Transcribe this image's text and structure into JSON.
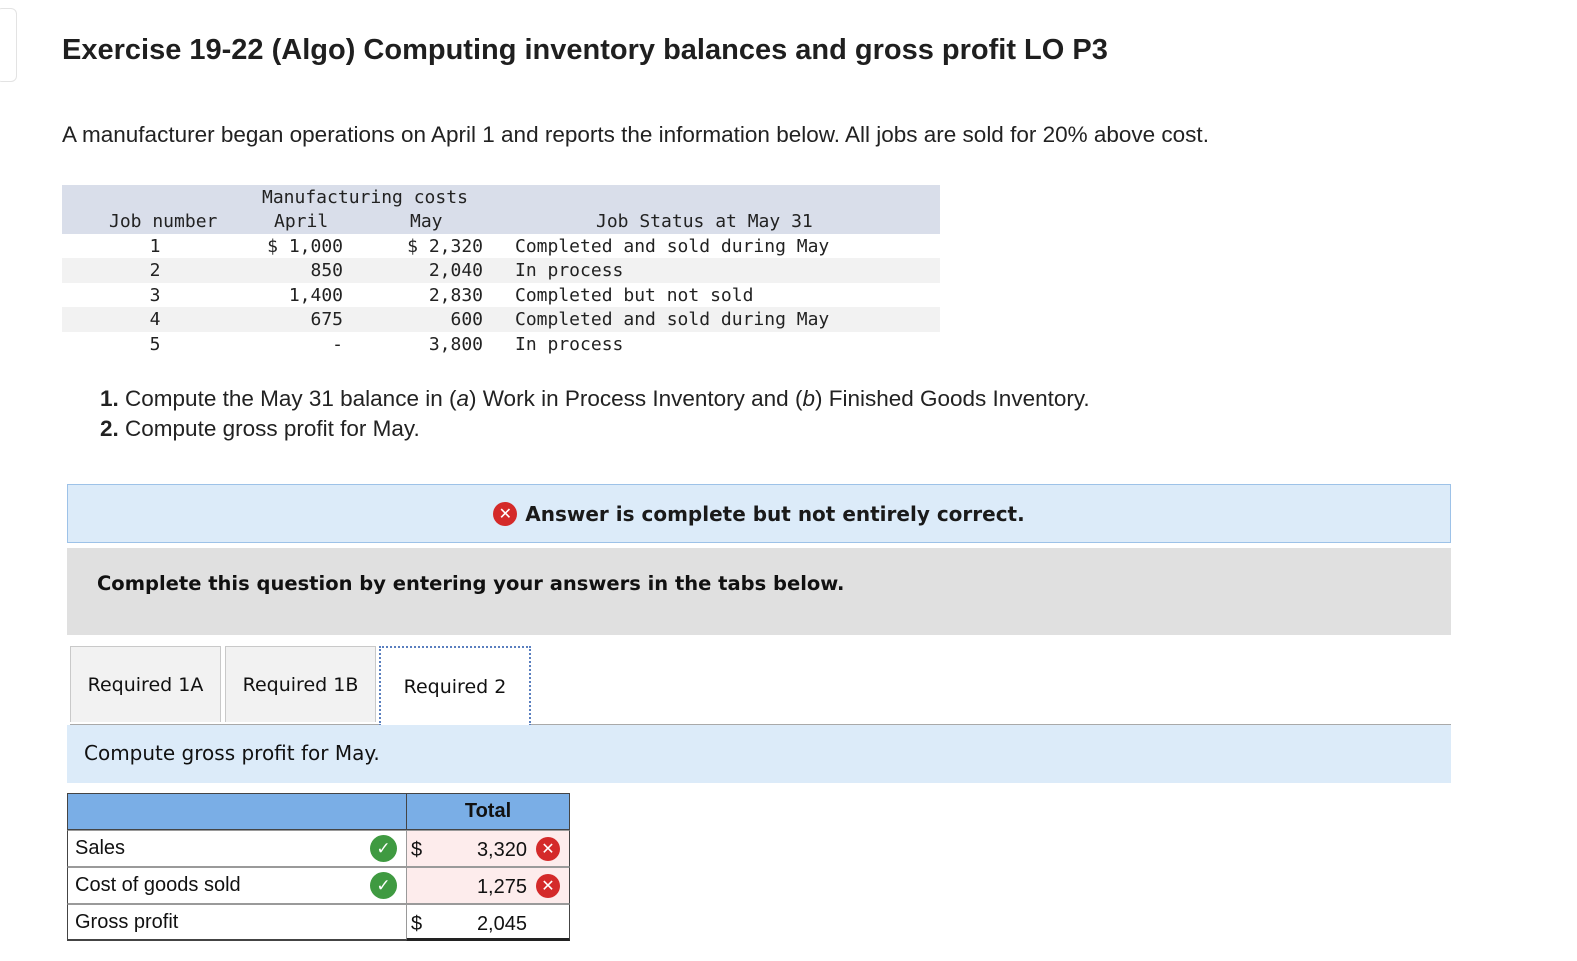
{
  "title": "Exercise 19-22 (Algo) Computing inventory balances and gross profit LO P3",
  "intro": "A manufacturer began operations on April 1 and reports the information below. All jobs are sold for 20% above cost.",
  "job_table": {
    "header_group": "Manufacturing costs",
    "headers": {
      "job": "Job number",
      "april": "April",
      "may": "May",
      "status": "Job Status at May 31"
    },
    "rows": [
      {
        "job": "1",
        "april": "$ 1,000",
        "may": "$ 2,320",
        "status": "Completed and sold during May"
      },
      {
        "job": "2",
        "april": "850",
        "may": "2,040",
        "status": "In process"
      },
      {
        "job": "3",
        "april": "1,400",
        "may": "2,830",
        "status": "Completed but not sold"
      },
      {
        "job": "4",
        "april": "675",
        "may": "600",
        "status": "Completed and sold during May"
      },
      {
        "job": "5",
        "april": "-",
        "may": "3,800",
        "status": "In process"
      }
    ]
  },
  "requirements": [
    {
      "num": "1.",
      "pre": "Compute the May 31 balance in (",
      "a": "a",
      "mid": ") Work in Process Inventory and (",
      "b": "b",
      "post": ") Finished Goods Inventory."
    },
    {
      "num": "2.",
      "text": "Compute gross profit for May."
    }
  ],
  "banner": {
    "icon": "x-icon",
    "text": "Answer is complete but not entirely correct."
  },
  "instruction": "Complete this question by entering your answers in the tabs below.",
  "tabs": [
    {
      "label": "Required 1A",
      "active": false
    },
    {
      "label": "Required 1B",
      "active": false
    },
    {
      "label": "Required 2",
      "active": true
    }
  ],
  "prompt": "Compute gross profit for May.",
  "answer": {
    "column_header": "Total",
    "rows": [
      {
        "label": "Sales",
        "dollar": "$",
        "value": "3,320",
        "label_status": "correct",
        "value_status": "incorrect"
      },
      {
        "label": "Cost of goods sold",
        "dollar": "",
        "value": "1,275",
        "label_status": "correct",
        "value_status": "incorrect"
      },
      {
        "label": "Gross profit",
        "dollar": "$",
        "value": "2,045",
        "label_status": "",
        "value_status": ""
      }
    ]
  },
  "colors": {
    "correct": "#3f9a41",
    "incorrect": "#d42a2a",
    "banner_bg": "#dcebf9",
    "header_bg": "#7aaee6"
  }
}
